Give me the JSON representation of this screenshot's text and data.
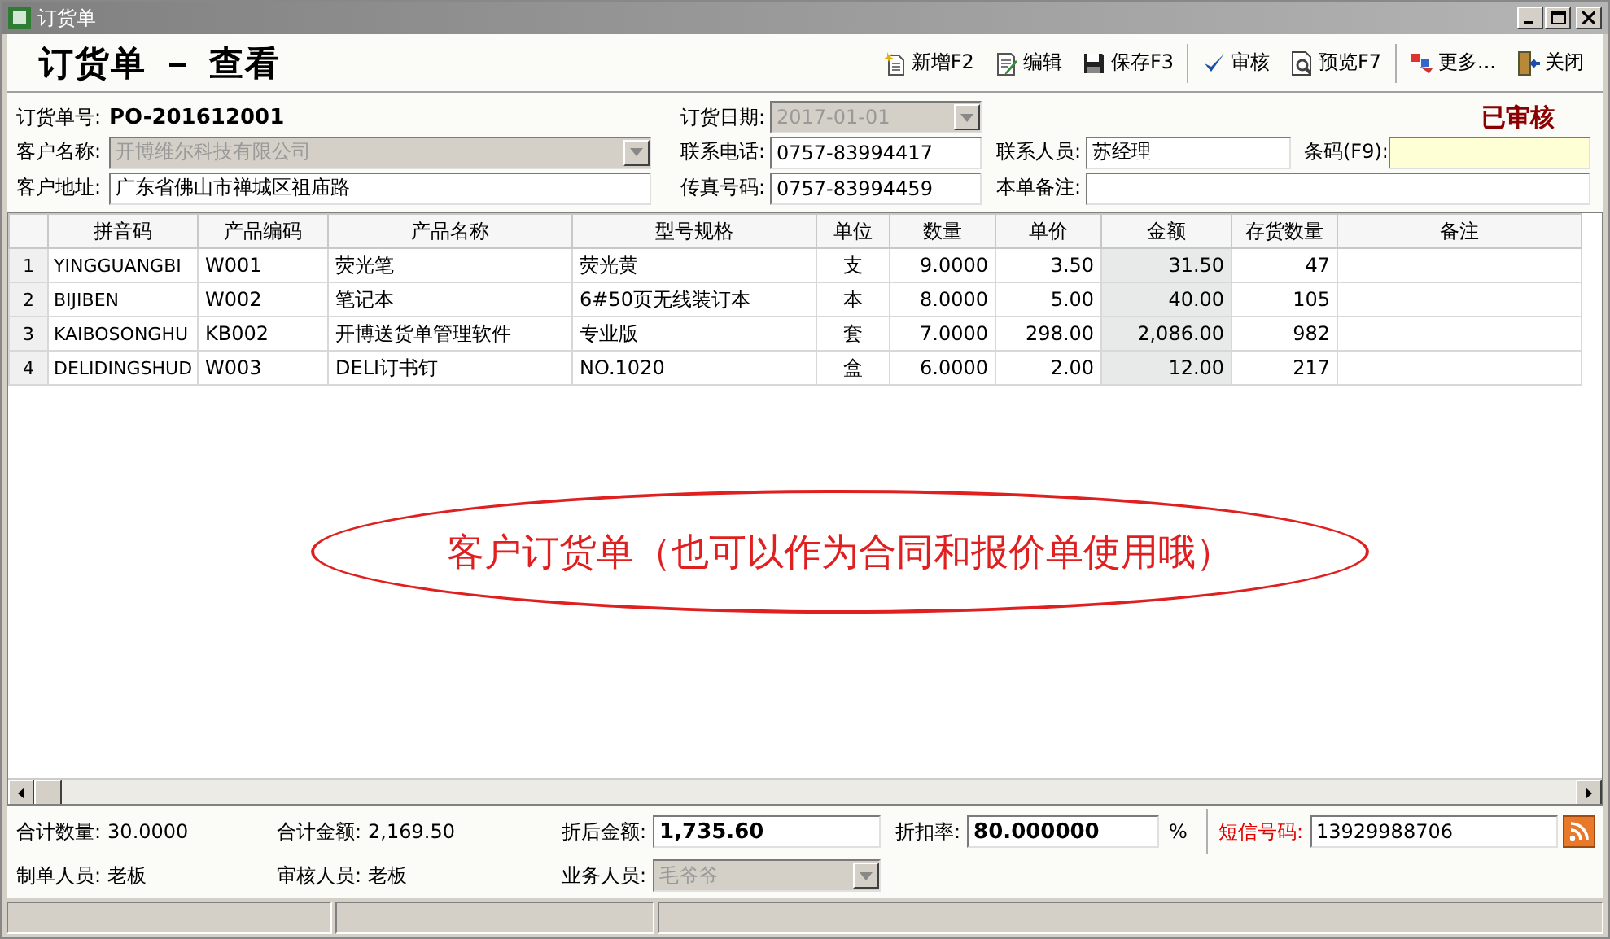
{
  "window": {
    "title": "订货单"
  },
  "header": {
    "title": "订货单 － 查看"
  },
  "toolbar": [
    {
      "label": "新增F2",
      "kind": "new"
    },
    {
      "label": "编辑",
      "kind": "edit"
    },
    {
      "label": "保存F3",
      "kind": "save"
    },
    {
      "label": "审核",
      "kind": "approve"
    },
    {
      "label": "预览F7",
      "kind": "preview"
    },
    {
      "label": "更多...",
      "kind": "more"
    },
    {
      "label": "关闭",
      "kind": "close"
    }
  ],
  "form": {
    "order_no": {
      "label": "订货单号:",
      "value": "PO-201612001"
    },
    "order_date": {
      "label": "订货日期:",
      "value": "2017-01-01",
      "disabled": true
    },
    "status": "已审核",
    "customer": {
      "label": "客户名称:",
      "value": "开博维尔科技有限公司",
      "disabled": true
    },
    "phone": {
      "label": "联系电话:",
      "value": "0757-83994417"
    },
    "contact": {
      "label": "联系人员:",
      "value": "苏经理"
    },
    "barcode": {
      "label": "条码(F9):"
    },
    "address": {
      "label": "客户地址:",
      "value": "广东省佛山市禅城区祖庙路"
    },
    "fax": {
      "label": "传真号码:",
      "value": "0757-83994459"
    },
    "remark": {
      "label": "本单备注:"
    }
  },
  "table": {
    "columns": [
      "拼音码",
      "产品编码",
      "产品名称",
      "型号规格",
      "单位",
      "数量",
      "单价",
      "金额",
      "存货数量",
      "备注"
    ],
    "rows": [
      {
        "number": "1",
        "cells": [
          "YINGGUANGBI",
          "W001",
          "荧光笔",
          "荧光黄",
          "支",
          "9.0000",
          "3.50",
          "31.50",
          "47"
        ]
      },
      {
        "number": "2",
        "cells": [
          "BIJIBEN",
          "W002",
          "笔记本",
          "6#50页无线装订本",
          "本",
          "8.0000",
          "5.00",
          "40.00",
          "105"
        ]
      },
      {
        "number": "3",
        "cells": [
          "KAIBOSONGHU",
          "KB002",
          "开博送货单管理软件",
          "专业版",
          "套",
          "7.0000",
          "298.00",
          "2,086.00",
          "982"
        ]
      },
      {
        "number": "4",
        "cells": [
          "DELIDINGSHUD",
          "W003",
          "DELI订书钉",
          "NO.1020",
          "盒",
          "6.0000",
          "2.00",
          "12.00",
          "217"
        ]
      }
    ]
  },
  "annotation": "客户订货单（也可以作为合同和报价单使用哦）",
  "footer": {
    "total_qty": {
      "label": "合计数量:",
      "value": "30.0000"
    },
    "total_amount": {
      "label": "合计金额:",
      "value": "2,169.50"
    },
    "net_amount": {
      "label": "折后金额:",
      "value": "1,735.60"
    },
    "discount": {
      "label": "折扣率:",
      "value": "80.000000",
      "unit": "%"
    },
    "sms": {
      "label": "短信号码:",
      "value": "13929988706"
    },
    "creator": {
      "label": "制单人员:",
      "value": "老板"
    },
    "approver": {
      "label": "审核人员:",
      "value": "老板"
    },
    "salesperson": {
      "label": "业务人员:",
      "value": "毛爷爷",
      "disabled": true
    }
  }
}
